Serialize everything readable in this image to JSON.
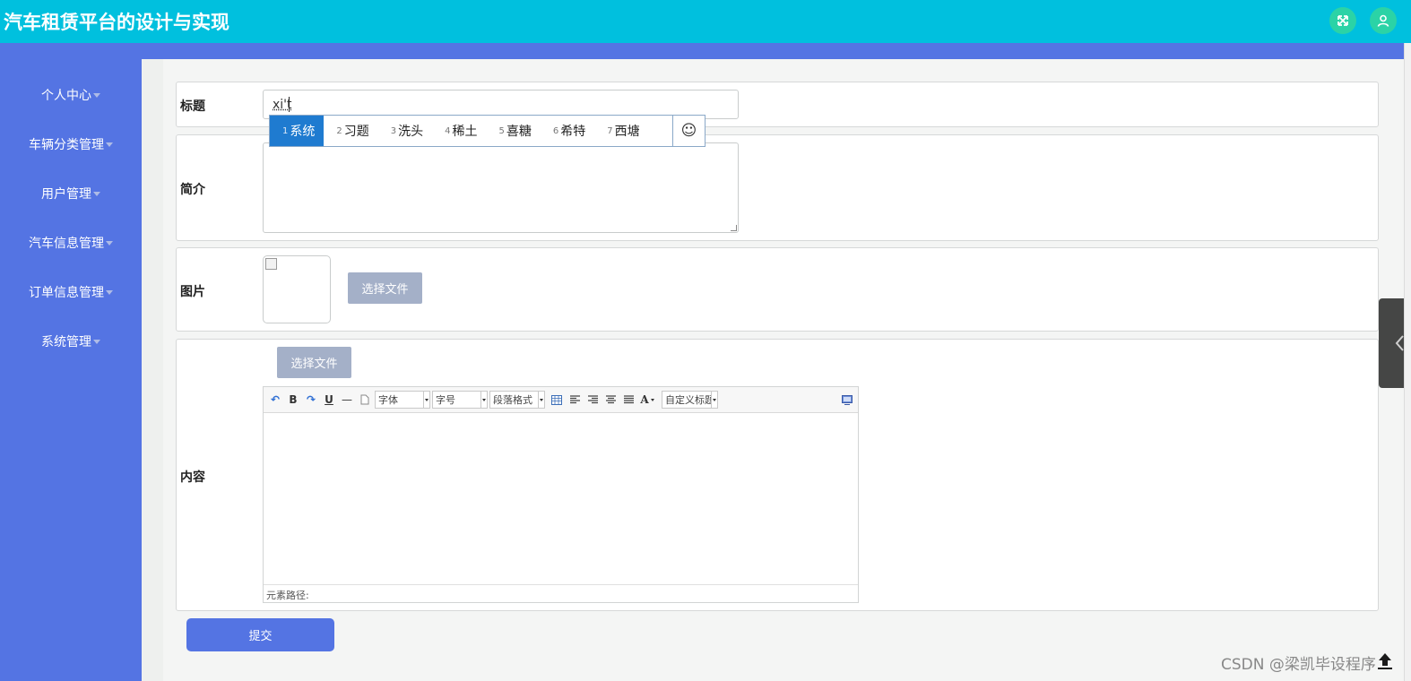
{
  "app": {
    "title": "汽车租赁平台的设计与实现"
  },
  "topbar": {
    "icons": [
      "fullscreen-icon",
      "user-icon"
    ]
  },
  "sidebar": {
    "items": [
      {
        "label": "个人中心"
      },
      {
        "label": "车辆分类管理"
      },
      {
        "label": "用户管理"
      },
      {
        "label": "汽车信息管理"
      },
      {
        "label": "订单信息管理"
      },
      {
        "label": "系统管理"
      }
    ]
  },
  "form": {
    "title_label": "标题",
    "title_value": "xi't",
    "intro_label": "简介",
    "intro_value": "",
    "image_label": "图片",
    "image_choose_label": "选择文件",
    "content_label": "内容",
    "content_choose_label": "选择文件",
    "submit_label": "提交"
  },
  "ime": {
    "candidates": [
      {
        "num": "1",
        "text": "系统",
        "selected": true
      },
      {
        "num": "2",
        "text": "习题"
      },
      {
        "num": "3",
        "text": "洗头"
      },
      {
        "num": "4",
        "text": "稀土"
      },
      {
        "num": "5",
        "text": "喜糖"
      },
      {
        "num": "6",
        "text": "希特"
      },
      {
        "num": "7",
        "text": "西塘"
      }
    ],
    "emoji_glyph": "☺"
  },
  "editor": {
    "toolbar": {
      "undo_glyph": "↶",
      "bold_glyph": "B",
      "redo_glyph": "↷",
      "underline_glyph": "U",
      "hr_glyph": "—",
      "font_family_placeholder": "字体",
      "font_size_placeholder": "字号",
      "paragraph_placeholder": "段落格式",
      "font_color_glyph": "A",
      "custom_title_placeholder": "自定义标题"
    },
    "element_path_label": "元素路径:"
  },
  "watermark": "CSDN @梁凯毕设程序",
  "colors": {
    "topbar": "#00c0de",
    "sidebar": "#5474e3",
    "ime_selected": "#1f7bd0",
    "top_button": "#2bd3a6"
  }
}
